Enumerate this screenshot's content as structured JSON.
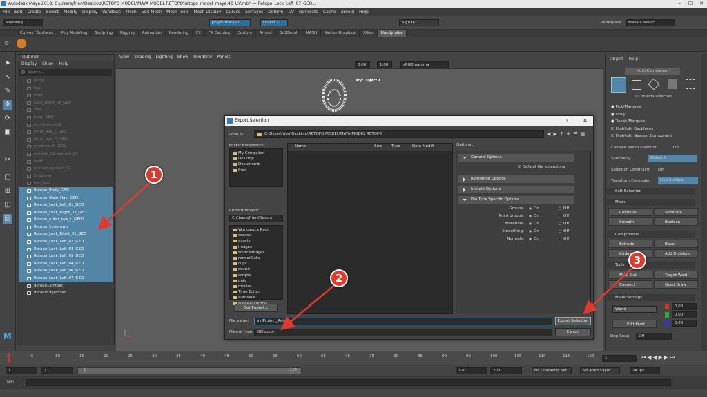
{
  "window": {
    "title": "Autodesk Maya 2018: C:\\Users\\frien\\Desktop\\RETOPO MODEL\\MAYA MODEL RETOPO\\retopo_model_maya.46_UV.mb*  ---  Retopo_Lock_Left_07_GEO..."
  },
  "menubar": [
    "File",
    "Edit",
    "Create",
    "Select",
    "Modify",
    "Display",
    "Windows",
    "Mesh",
    "Edit Mesh",
    "Mesh Tools",
    "Mesh Display",
    "Curves",
    "Surfaces",
    "Deform",
    "UV",
    "Generate",
    "Cache",
    "Arnold",
    "Help"
  ],
  "workspace": {
    "label": "Workspace :",
    "value": "Maya Classic*"
  },
  "statusline": {
    "mode": "Modeling",
    "object1": "polySurface23",
    "object2": "Object X",
    "signin": "Sign In"
  },
  "shelf_tabs": [
    "Curves / Surfaces",
    "Poly Modeling",
    "Sculpting",
    "Rigging",
    "Animation",
    "Rendering",
    "FX",
    "FX Caching",
    "Custom",
    "Arnold",
    "GoZBrush",
    "MASH",
    "Motion Graphics",
    "XGen",
    "Handytales"
  ],
  "shelf_active": "Handytales",
  "outliner": {
    "title": "Outliner",
    "menu": [
      "Display",
      "Show",
      "Help"
    ],
    "search_placeholder": "Search...",
    "items": [
      {
        "label": "persp",
        "state": "dim"
      },
      {
        "label": "top",
        "state": "dim"
      },
      {
        "label": "front",
        "state": "dim"
      },
      {
        "label": "Lock_Right_03_GEO",
        "state": "dim"
      },
      {
        "label": "side",
        "state": "dim"
      },
      {
        "label": "body_GEO",
        "state": "dim"
      },
      {
        "label": "polySurface23",
        "state": "dim"
      },
      {
        "label": "inner_eye_L_GEO",
        "state": "dim"
      },
      {
        "label": "inner_eye_R_GEO",
        "state": "dim"
      },
      {
        "label": "eyebrow_R_GEO1",
        "state": "dim"
      },
      {
        "label": "eyelash_02:eyelash_02",
        "state": "dim"
      },
      {
        "label": "teeth",
        "state": "dim"
      },
      {
        "label": "eyelash:eyelash_01",
        "state": "dim"
      },
      {
        "label": "Eyebrown",
        "state": "dim"
      },
      {
        "label": "hair_geo",
        "state": "dim"
      },
      {
        "label": "Retopo_Body_GEO",
        "state": "sel"
      },
      {
        "label": "Retopo_Main_Hair_GEO",
        "state": "sel"
      },
      {
        "label": "Retopo_Lock_Left_01_GEO",
        "state": "sel"
      },
      {
        "label": "Retopo_Lock_Right_02_GEO",
        "state": "sel"
      },
      {
        "label": "Retopo_outer_eye_L_GEO1",
        "state": "sel"
      },
      {
        "label": "Retopo_Eyebrown",
        "state": "sel"
      },
      {
        "label": "Retopo_Lock_Right_01_GEO",
        "state": "sel"
      },
      {
        "label": "Retopo_Lock_Left_02_GEO",
        "state": "sel"
      },
      {
        "label": "Retopo_Lock_Left_03_GEO",
        "state": "sel"
      },
      {
        "label": "Retopo_Lock_Left_05_GEO",
        "state": "sel"
      },
      {
        "label": "Retopo_Lock_Left_04_GEO",
        "state": "sel"
      },
      {
        "label": "Retopo_Lock_Left_06_GEO",
        "state": "sel"
      },
      {
        "label": "Retopo_Lock_Left_07_GEO",
        "state": "sel"
      },
      {
        "label": "defaultLightSet",
        "state": "norm"
      },
      {
        "label": "defaultObjectSet",
        "state": "norm"
      }
    ]
  },
  "viewport": {
    "menu": [
      "View",
      "Shading",
      "Lighting",
      "Show",
      "Renderer",
      "Panels"
    ],
    "field1": "0.00",
    "field2": "1.00",
    "colorspace": "sRGB gamma",
    "hud": "ery: Object X"
  },
  "dialog": {
    "title": "Export Selection",
    "help": "?",
    "close": "✕",
    "look_in_label": "Look in:",
    "look_in_path": "C:\\Users\\frien\\Desktop\\RETOPO MODEL\\MAYA MODEL RETOPO",
    "folder_bookmarks_label": "Folder Bookmarks:",
    "bookmarks": [
      "My Computer",
      "Desktop",
      "Documents",
      "frien"
    ],
    "current_project_label": "Current Project:",
    "current_project": "C:/Users/frien/Deskto",
    "project_tree": [
      "Workspace Root",
      "scenes",
      "assets",
      "images",
      "sourceimages",
      "renderData",
      "clips",
      "sound",
      "scripts",
      "data",
      "movies",
      "Time Editor",
      "autosave",
      "sceneAssembly"
    ],
    "set_project": "Set Project...",
    "columns": [
      "Name",
      "Size",
      "Type",
      "Date Modifi"
    ],
    "options_label": "Options...",
    "sections": {
      "general": "General Options",
      "default_ext": "Default file extensions",
      "reference": "Reference Options",
      "include": "Include Options",
      "file_type": "File Type Specific Options"
    },
    "radio_rows": [
      {
        "label": "Groups:",
        "on": "On",
        "off": "Off"
      },
      {
        "label": "Point groups:",
        "on": "On",
        "off": "Off"
      },
      {
        "label": "Materials:",
        "on": "On",
        "off": "Off"
      },
      {
        "label": "Smoothing:",
        "on": "On",
        "off": "Off"
      },
      {
        "label": "Normals:",
        "on": "On",
        "off": "Off"
      }
    ],
    "file_name_label": "File name:",
    "file_name": "girlProject_Retopo",
    "file_type_label": "Files of type:",
    "file_type": "OBJexport",
    "export_btn": "Export Selection",
    "cancel_btn": "Cancel"
  },
  "attribute": {
    "menu": [
      "Object",
      "Help"
    ],
    "mode": "Multi-Component",
    "selected": "13 objects selected",
    "checks": [
      {
        "label": "Pick/Marquee",
        "type": "radio"
      },
      {
        "label": "Drag",
        "type": "radio"
      },
      {
        "label": "Tweak/Marquee",
        "type": "radio"
      },
      {
        "label": "Highlight Backfaces",
        "type": "check"
      },
      {
        "label": "Highlight Nearest Component",
        "type": "check"
      }
    ],
    "camera_based": "Camera Based Selection",
    "camera_based_val": "Off",
    "symmetry_label": "Symmetry",
    "symmetry_val": "Object X",
    "sel_constraint": "Selection Constraint",
    "sel_constraint_val": "Off",
    "transform_constraint": "Transform Constraint",
    "transform_constraint_val": "Live Surface",
    "soft_selection": "Soft Selection",
    "mesh": "Mesh",
    "combine": "Combine",
    "separate": "Separate",
    "smooth": "Smooth",
    "boolean": "Boolean",
    "components": "Components",
    "extrude": "Extrude",
    "bevel": "Bevel",
    "bridge": "Bridge",
    "add_divisions": "Add Divisions",
    "tools": "Tools",
    "multicut": "Multi-Cut",
    "target_weld": "Target Weld",
    "connect": "Connect",
    "quad_draw": "Quad Draw",
    "move_settings": "Move Settings",
    "world": "World",
    "edit_pivot": "Edit Pivot",
    "x": "0.00",
    "y": "0.00",
    "z": "0.00",
    "step_snap": "Step Snap:",
    "step_snap_val": "Off",
    "side_tabs": [
      "Channel Box / Layer Editor",
      "Modeling Toolkit",
      "Attribute Editor"
    ]
  },
  "timeline": {
    "ticks": [
      "1",
      "5",
      "10",
      "15",
      "20",
      "25",
      "30",
      "35",
      "40",
      "45",
      "50",
      "55",
      "60",
      "65",
      "70",
      "75",
      "80",
      "85",
      "90",
      "95",
      "100",
      "105",
      "110",
      "115",
      "120"
    ],
    "current": "1"
  },
  "range": {
    "start1": "1",
    "start2": "1",
    "mid": "1",
    "bar_end": "120",
    "end1": "120",
    "end2": "200",
    "character": "No Character Set",
    "anim_layer": "No Anim Layer",
    "fps": "24 fps"
  },
  "cmd": {
    "lang": "MEL"
  },
  "annotations": [
    "1",
    "2",
    "3"
  ],
  "colors": {
    "selection": "#5285a6",
    "annotation": "#e03a2f"
  }
}
